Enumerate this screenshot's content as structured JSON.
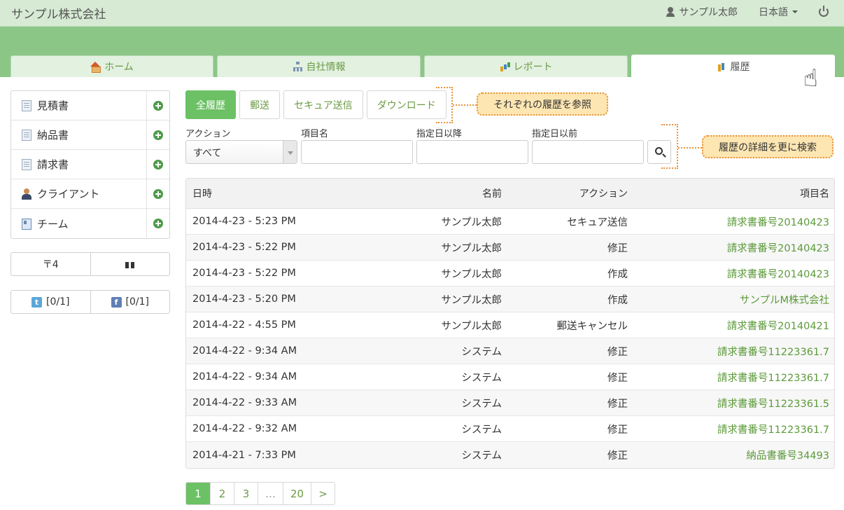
{
  "header": {
    "brand": "サンプル株式会社",
    "user": "サンプル太郎",
    "language": "日本語"
  },
  "tabs": [
    {
      "label": "ホーム",
      "icon": "home-icon"
    },
    {
      "label": "自社情報",
      "icon": "org-chart-icon"
    },
    {
      "label": "レポート",
      "icon": "bar-chart-icon"
    },
    {
      "label": "履歴",
      "icon": "history-icon",
      "active": true
    }
  ],
  "sidebar": {
    "items": [
      {
        "label": "見積書",
        "icon": "document-icon"
      },
      {
        "label": "納品書",
        "icon": "document-icon"
      },
      {
        "label": "請求書",
        "icon": "invoice-icon"
      },
      {
        "label": "クライアント",
        "icon": "person-icon"
      },
      {
        "label": "チーム",
        "icon": "id-card-icon"
      }
    ],
    "postal": "〒4",
    "twitter": "[0/1]",
    "facebook": "[0/1]"
  },
  "filters": [
    "全履歴",
    "郵送",
    "セキュア送信",
    "ダウンロード"
  ],
  "callouts": {
    "filters": "それぞれの履歴を参照",
    "search": "履歴の詳細を更に検索"
  },
  "search": {
    "action_label": "アクション",
    "action_value": "すべて",
    "item_label": "項目名",
    "from_label": "指定日以降",
    "to_label": "指定日以前"
  },
  "table": {
    "headers": [
      "日時",
      "名前",
      "アクション",
      "項目名"
    ],
    "rows": [
      [
        "2014-4-23 - 5:23 PM",
        "サンプル太郎",
        "セキュア送信",
        "請求書番号20140423"
      ],
      [
        "2014-4-23 - 5:22 PM",
        "サンプル太郎",
        "修正",
        "請求書番号20140423"
      ],
      [
        "2014-4-23 - 5:22 PM",
        "サンプル太郎",
        "作成",
        "請求書番号20140423"
      ],
      [
        "2014-4-23 - 5:20 PM",
        "サンプル太郎",
        "作成",
        "サンプルM株式会社"
      ],
      [
        "2014-4-22 - 4:55 PM",
        "サンプル太郎",
        "郵送キャンセル",
        "請求書番号20140421"
      ],
      [
        "2014-4-22 - 9:34 AM",
        "システム",
        "修正",
        "請求書番号11223361.7"
      ],
      [
        "2014-4-22 - 9:34 AM",
        "システム",
        "修正",
        "請求書番号11223361.7"
      ],
      [
        "2014-4-22 - 9:33 AM",
        "システム",
        "修正",
        "請求書番号11223361.5"
      ],
      [
        "2014-4-22 - 9:32 AM",
        "システム",
        "修正",
        "請求書番号11223361.7"
      ],
      [
        "2014-4-21 - 7:33 PM",
        "システム",
        "修正",
        "納品書番号34493"
      ]
    ]
  },
  "pagination": [
    "1",
    "2",
    "3",
    "…",
    "20",
    ">"
  ],
  "colors": {
    "accent": "#6cc165",
    "band": "#8cc686",
    "link": "#5c9a3a",
    "callout": "#fde6b2"
  }
}
